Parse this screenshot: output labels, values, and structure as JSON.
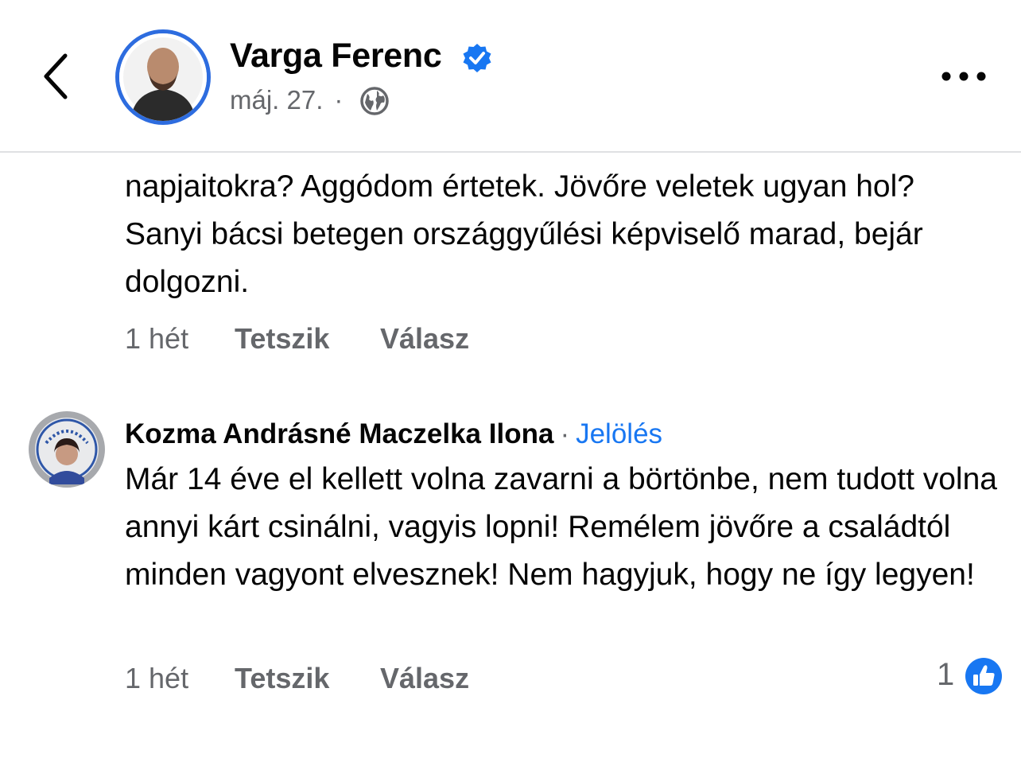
{
  "header": {
    "author_name": "Varga Ferenc",
    "date": "máj. 27.",
    "separator": "·"
  },
  "comments": [
    {
      "text": "napjaitokra? Aggódom értetek. Jövőre veletek ugyan hol? Sanyi bácsi betegen országgyűlési képviselő marad, bejár dolgozni.",
      "time": "1 hét",
      "like_label": "Tetszik",
      "reply_label": "Válasz"
    },
    {
      "author": "Kozma Andrásné Maczelka Ilona",
      "separator": "·",
      "tag_label": "Jelölés",
      "text": "Már 14 éve el kellett volna zavarni a börtönbe, nem tudott volna annyi kárt csinálni, vagyis lopni! Remélem jövőre a családtól minden vagyont elvesznek! Nem hagyjuk, hogy ne így legyen!",
      "time": "1 hét",
      "like_label": "Tetszik",
      "reply_label": "Válasz",
      "reaction_count": "1"
    }
  ],
  "colors": {
    "accent": "#1877f2",
    "avatar_ring": "#2d6cdf",
    "muted_text": "#65676b",
    "divider": "#dfe0e3"
  },
  "icons": {
    "back": "chevron-left-icon",
    "verified": "verified-badge-icon",
    "globe": "globe-icon",
    "more": "more-dots-icon",
    "like": "like-thumb-icon"
  }
}
